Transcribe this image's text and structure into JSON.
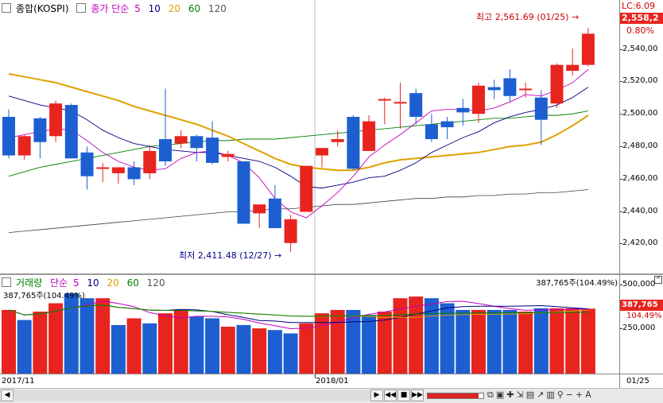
{
  "legend": {
    "code": "종합(KOSPI)",
    "price_label": "종가 단순",
    "ma": [
      "5",
      "10",
      "20",
      "60",
      "120"
    ],
    "ma_colors": [
      "#c000c0",
      "#000080",
      "#e0a000",
      "#008000",
      "#404040"
    ]
  },
  "price_axis": {
    "label_top": "LC:6.09",
    "tick_labels": [
      "2,540,00",
      "2,520,00",
      "2,500,00",
      "2,480,00",
      "2,460,00",
      "2,440,00",
      "2,420,00"
    ],
    "last_price": "2,558,2",
    "change_pct": "0.80%"
  },
  "annotations": {
    "high": "최고 2,561.69 (01/25)",
    "low": "최저 2,411.48 (12/27)"
  },
  "volume_legend": {
    "label": "거래량",
    "ma_label": "단순",
    "ma": [
      "5",
      "10",
      "20",
      "60",
      "120"
    ],
    "ma_colors": [
      "#c000c0",
      "#000080",
      "#e0a000",
      "#008000",
      "#404040"
    ],
    "value_left": "387,765주(104.49%)",
    "value_right": "387,765주(104.49%)"
  },
  "volume_axis": {
    "tick_labels": [
      "500,000",
      "250,000"
    ],
    "last_volume": "387,765",
    "pct": "104.49%"
  },
  "time_axis": {
    "labels": [
      "2017/11",
      "2018/01"
    ],
    "right_label": "01/25"
  },
  "chart_data": {
    "type": "candlestick",
    "series_count": 38,
    "candles": [
      {
        "o": 2502,
        "h": 2507,
        "l": 2474,
        "c": 2476
      },
      {
        "o": 2476,
        "h": 2490,
        "l": 2473,
        "c": 2489
      },
      {
        "o": 2501,
        "h": 2502,
        "l": 2474,
        "c": 2485
      },
      {
        "o": 2489,
        "h": 2513,
        "l": 2485,
        "c": 2511
      },
      {
        "o": 2510,
        "h": 2511,
        "l": 2474,
        "c": 2474
      },
      {
        "o": 2478,
        "h": 2482,
        "l": 2453,
        "c": 2462
      },
      {
        "o": 2468,
        "h": 2471,
        "l": 2458,
        "c": 2468
      },
      {
        "o": 2464,
        "h": 2468,
        "l": 2457,
        "c": 2468
      },
      {
        "o": 2468,
        "h": 2472,
        "l": 2456,
        "c": 2460
      },
      {
        "o": 2464,
        "h": 2483,
        "l": 2460,
        "c": 2479
      },
      {
        "o": 2487,
        "h": 2521,
        "l": 2469,
        "c": 2472
      },
      {
        "o": 2484,
        "h": 2493,
        "l": 2481,
        "c": 2489
      },
      {
        "o": 2489,
        "h": 2490,
        "l": 2472,
        "c": 2481
      },
      {
        "o": 2488,
        "h": 2499,
        "l": 2470,
        "c": 2471
      },
      {
        "o": 2475,
        "h": 2479,
        "l": 2472,
        "c": 2477
      },
      {
        "o": 2472,
        "h": 2472,
        "l": 2430,
        "c": 2430
      },
      {
        "o": 2437,
        "h": 2442,
        "l": 2427,
        "c": 2443
      },
      {
        "o": 2447,
        "h": 2456,
        "l": 2427,
        "c": 2427
      },
      {
        "o": 2417,
        "h": 2436,
        "l": 2411,
        "c": 2433
      },
      {
        "o": 2438,
        "h": 2469,
        "l": 2438,
        "c": 2469
      },
      {
        "o": 2476,
        "h": 2481,
        "l": 2468,
        "c": 2481
      },
      {
        "o": 2485,
        "h": 2493,
        "l": 2482,
        "c": 2487
      },
      {
        "o": 2502,
        "h": 2503,
        "l": 2466,
        "c": 2467
      },
      {
        "o": 2479,
        "h": 2503,
        "l": 2479,
        "c": 2499
      },
      {
        "o": 2513,
        "h": 2515,
        "l": 2497,
        "c": 2514
      },
      {
        "o": 2512,
        "h": 2525,
        "l": 2494,
        "c": 2512
      },
      {
        "o": 2518,
        "h": 2521,
        "l": 2497,
        "c": 2502
      },
      {
        "o": 2497,
        "h": 2504,
        "l": 2485,
        "c": 2487
      },
      {
        "o": 2499,
        "h": 2502,
        "l": 2487,
        "c": 2495
      },
      {
        "o": 2508,
        "h": 2514,
        "l": 2496,
        "c": 2505
      },
      {
        "o": 2504,
        "h": 2525,
        "l": 2498,
        "c": 2523
      },
      {
        "o": 2522,
        "h": 2527,
        "l": 2514,
        "c": 2520
      },
      {
        "o": 2528,
        "h": 2534,
        "l": 2512,
        "c": 2516
      },
      {
        "o": 2520,
        "h": 2525,
        "l": 2515,
        "c": 2521
      },
      {
        "o": 2515,
        "h": 2520,
        "l": 2483,
        "c": 2500
      },
      {
        "o": 2511,
        "h": 2538,
        "l": 2508,
        "c": 2537
      },
      {
        "o": 2533,
        "h": 2548,
        "l": 2530,
        "c": 2537
      },
      {
        "o": 2537,
        "h": 2562,
        "l": 2536,
        "c": 2558
      }
    ],
    "ma5": [
      2488,
      2490,
      2492,
      2494,
      2493,
      2486,
      2478,
      2472,
      2468,
      2466,
      2467,
      2474,
      2478,
      2479,
      2476,
      2471,
      2461,
      2447,
      2438,
      2434,
      2442,
      2451,
      2462,
      2475,
      2483,
      2490,
      2498,
      2506,
      2507,
      2507,
      2506,
      2508,
      2512,
      2517,
      2516,
      2520,
      2525,
      2534
    ],
    "ma10": [
      2516,
      2513,
      2510,
      2508,
      2506,
      2500,
      2493,
      2488,
      2484,
      2482,
      2480,
      2479,
      2478,
      2478,
      2476,
      2474,
      2472,
      2468,
      2462,
      2455,
      2454,
      2456,
      2458,
      2461,
      2462,
      2466,
      2471,
      2478,
      2483,
      2488,
      2492,
      2498,
      2502,
      2505,
      2507,
      2510,
      2515,
      2522
    ],
    "ma20": [
      2531,
      2529,
      2527,
      2525,
      2522,
      2519,
      2516,
      2513,
      2509,
      2506,
      2503,
      2500,
      2497,
      2493,
      2489,
      2484,
      2479,
      2474,
      2470,
      2468,
      2467,
      2466,
      2466,
      2468,
      2471,
      2473,
      2474,
      2475,
      2476,
      2477,
      2478,
      2480,
      2482,
      2483,
      2485,
      2490,
      2496,
      2503
    ],
    "ma60": [
      2462,
      2465,
      2468,
      2470,
      2472,
      2474,
      2476,
      2478,
      2480,
      2482,
      2483,
      2484,
      2485,
      2486,
      2486,
      2487,
      2487,
      2487,
      2488,
      2489,
      2490,
      2491,
      2492,
      2493,
      2494,
      2495,
      2496,
      2497,
      2498,
      2499,
      2500,
      2501,
      2501,
      2502,
      2503,
      2503,
      2504,
      2506
    ],
    "ma120": [
      2424,
      2425,
      2426,
      2427,
      2428,
      2429,
      2430,
      2431,
      2432,
      2433,
      2434,
      2435,
      2436,
      2437,
      2438,
      2438,
      2439,
      2440,
      2440,
      2441,
      2442,
      2443,
      2443,
      2444,
      2445,
      2446,
      2447,
      2447,
      2448,
      2448,
      2449,
      2449,
      2450,
      2450,
      2451,
      2451,
      2452,
      2453
    ],
    "volume": [
      380000,
      320000,
      370000,
      420000,
      480000,
      450000,
      450000,
      290000,
      330000,
      300000,
      360000,
      380000,
      340000,
      330000,
      280000,
      290000,
      270000,
      260000,
      240000,
      300000,
      360000,
      380000,
      380000,
      350000,
      370000,
      450000,
      460000,
      450000,
      420000,
      380000,
      380000,
      380000,
      380000,
      370000,
      390000,
      390000,
      390000,
      387765
    ],
    "volume_colors": [
      "up",
      "down",
      "up",
      "up",
      "down",
      "down",
      "up",
      "down",
      "up",
      "down",
      "up",
      "up",
      "down",
      "down",
      "up",
      "down",
      "up",
      "down",
      "down",
      "up",
      "up",
      "up",
      "down",
      "down",
      "up",
      "up",
      "up",
      "down",
      "down",
      "down",
      "up",
      "down",
      "down",
      "up",
      "down",
      "up",
      "up",
      "up"
    ],
    "price_range": [
      2404,
      2570
    ],
    "volume_range": [
      0,
      560000
    ],
    "x_labels": [
      "2017/11",
      "2018/01",
      "01/25"
    ]
  }
}
